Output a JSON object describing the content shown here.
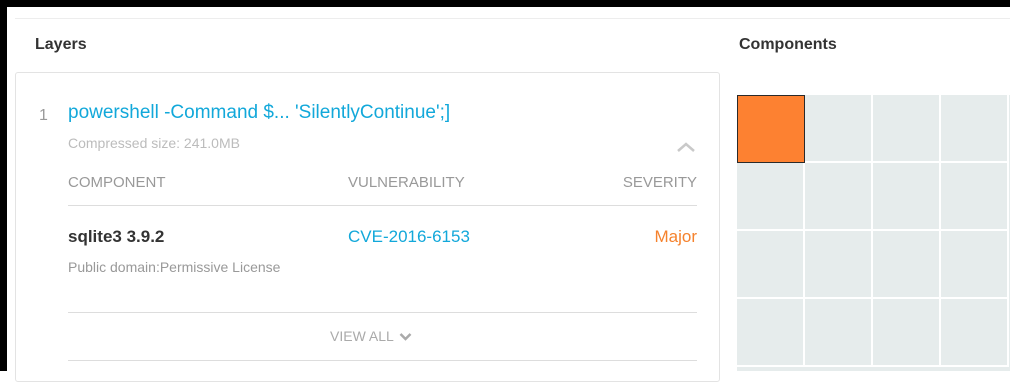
{
  "layers_panel": {
    "title": "Layers",
    "layer": {
      "index": "1",
      "command": "powershell -Command $... 'SilentlyContinue';]",
      "compressed_size": "Compressed size: 241.0MB",
      "table": {
        "headers": [
          "COMPONENT",
          "VULNERABILITY",
          "SEVERITY"
        ],
        "rows": [
          {
            "component": "sqlite3 3.9.2",
            "license": "Public domain:Permissive License",
            "vulnerability": "CVE-2016-6153",
            "severity": "Major"
          }
        ]
      },
      "view_all_label": "VIEW ALL"
    }
  },
  "components_panel": {
    "title": "Components",
    "grid": {
      "columns": 4,
      "rows": 4,
      "highlighted_cell": 0,
      "highlight_color": "#fd8131",
      "cell_color": "#e6ecec"
    }
  },
  "colors": {
    "link": "#12a8da",
    "severity_major": "#f5822d",
    "muted": "#999999"
  },
  "icons": {
    "collapse": "chevron-up-icon",
    "expand": "chevron-down-icon"
  }
}
